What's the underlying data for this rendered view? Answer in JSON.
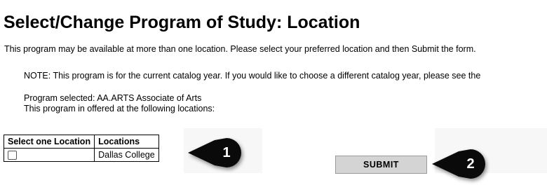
{
  "page": {
    "title": "Select/Change Program of Study: Location",
    "intro": "This program may be available at more than one location. Please select your preferred location and then Submit the form.",
    "note": "NOTE: This program is for the current catalog year. If you would like to choose a different catalog year, please see the",
    "program_selected": "Program selected: AA.ARTS Associate of Arts",
    "offered_at": "This program in offered at the following locations:"
  },
  "location_table": {
    "headers": [
      "Select one Location",
      "Locations"
    ],
    "rows": [
      {
        "checked": false,
        "location": "Dallas College"
      }
    ]
  },
  "submit_label": "SUBMIT",
  "callouts": [
    "1",
    "2"
  ],
  "colors": {
    "callout": "#0a0a0a",
    "button": "#d4d4d4",
    "shade": "#f7f7f7"
  }
}
